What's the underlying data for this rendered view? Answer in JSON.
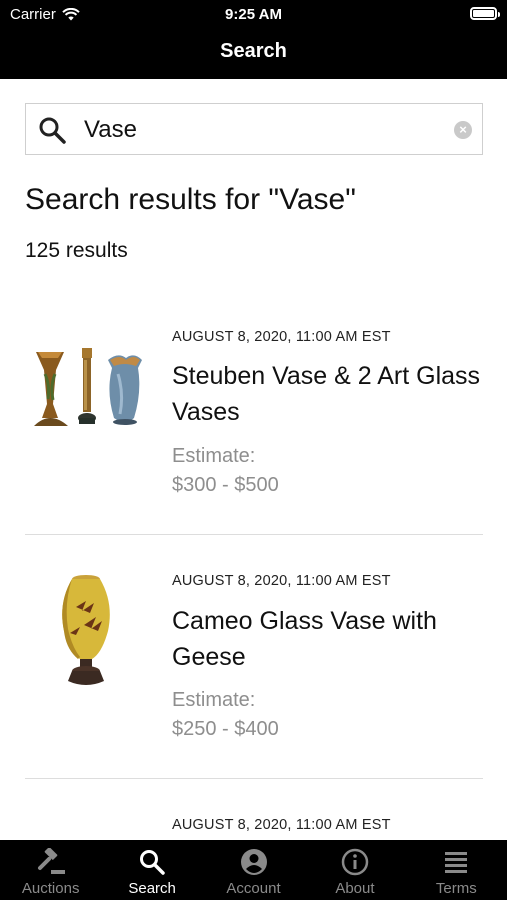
{
  "status_bar": {
    "carrier": "Carrier",
    "time": "9:25 AM"
  },
  "nav": {
    "title": "Search"
  },
  "search": {
    "value": "Vase",
    "clear_label": "×"
  },
  "results": {
    "heading": "Search results for \"Vase\"",
    "count": "125 results"
  },
  "items": [
    {
      "date": "AUGUST 8, 2020, 11:00 AM EST",
      "title": "Steuben Vase & 2 Art Glass Vases",
      "estimate_label": "Estimate:",
      "estimate_value": "$300 - $500"
    },
    {
      "date": "AUGUST 8, 2020, 11:00 AM EST",
      "title": "Cameo Glass Vase with Geese",
      "estimate_label": "Estimate:",
      "estimate_value": "$250 - $400"
    },
    {
      "date": "AUGUST 8, 2020, 11:00 AM EST"
    }
  ],
  "tabbar": {
    "active": "search",
    "tabs": [
      {
        "id": "auctions",
        "label": "Auctions",
        "icon": "gavel-icon"
      },
      {
        "id": "search",
        "label": "Search",
        "icon": "search-icon"
      },
      {
        "id": "account",
        "label": "Account",
        "icon": "account-icon"
      },
      {
        "id": "about",
        "label": "About",
        "icon": "info-icon"
      },
      {
        "id": "terms",
        "label": "Terms",
        "icon": "list-icon"
      }
    ]
  },
  "colors": {
    "bar_background": "#000000",
    "active_tab": "#ffffff",
    "inactive_tab": "#8a8a8a",
    "estimate_text": "#8e8e8e"
  }
}
